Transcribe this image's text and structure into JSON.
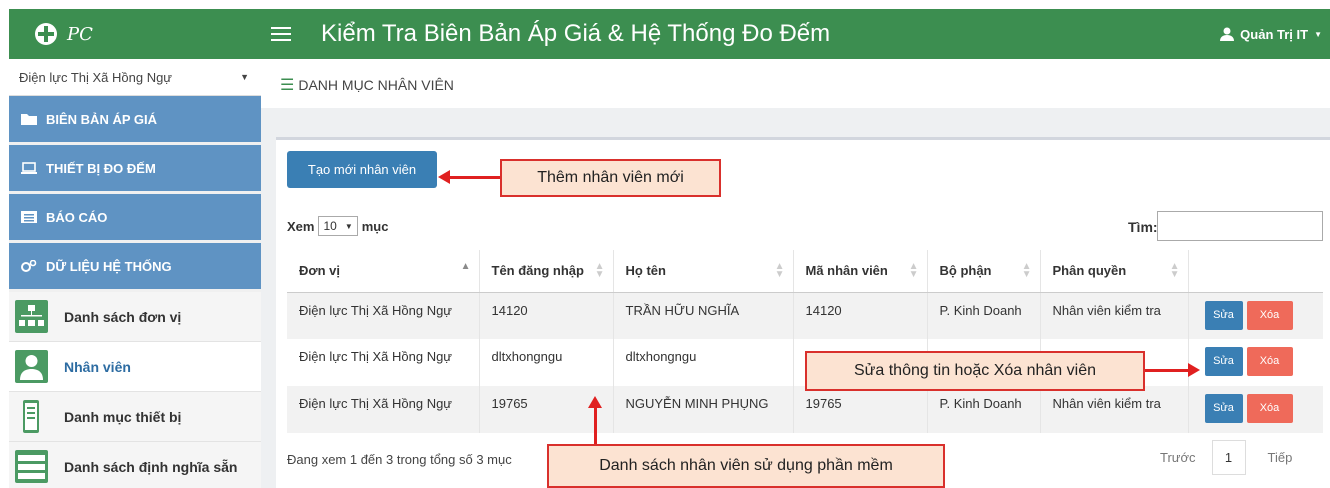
{
  "brand": {
    "text": "PC"
  },
  "sidebar": {
    "unit_select": "Điện lực Thị Xã Hồng Ngự",
    "menu": [
      {
        "label": "BIÊN BẢN ÁP GIÁ",
        "icon": "folder-icon"
      },
      {
        "label": "THIẾT BỊ ĐO ĐẾM",
        "icon": "laptop-icon"
      },
      {
        "label": "BÁO CÁO",
        "icon": "list-alt-icon"
      },
      {
        "label": "DỮ LIỆU HỆ THỐNG",
        "icon": "cogs-icon"
      }
    ],
    "sub_items": [
      {
        "label": "Danh sách đơn vị",
        "icon": "org-chart-icon"
      },
      {
        "label": "Nhân viên",
        "icon": "user-icon"
      },
      {
        "label": "Danh mục thiết bị",
        "icon": "device-icon"
      },
      {
        "label": "Danh sách định nghĩa sẵn",
        "icon": "table-icon"
      }
    ]
  },
  "topbar": {
    "title": "Kiểm Tra Biên Bản Áp Giá & Hệ Thống Đo Đếm",
    "user": "Quản Trị IT"
  },
  "page": {
    "header": "DANH MỤC NHÂN VIÊN",
    "create_button": "Tạo mới nhân viên",
    "show_label": "Xem",
    "show_value": "10",
    "show_suffix": "mục",
    "search_label": "Tìm:",
    "info": "Đang xem 1 đến 3 trong tổng số 3 mục",
    "pager": {
      "prev": "Trước",
      "page": "1",
      "next": "Tiếp"
    }
  },
  "table": {
    "headers": [
      "Đơn vị",
      "Tên đăng nhập",
      "Họ tên",
      "Mã nhân viên",
      "Bộ phận",
      "Phân quyền"
    ],
    "rows": [
      [
        "Điện lực Thị Xã Hồng Ngự",
        "14120",
        "TRẦN HỮU NGHĨA",
        "14120",
        "P. Kinh Doanh",
        "Nhân viên kiểm tra"
      ],
      [
        "Điện lực Thị Xã Hồng Ngự",
        "dltxhongngu",
        "dltxhongngu",
        "",
        "",
        ""
      ],
      [
        "Điện lực Thị Xã Hồng Ngự",
        "19765",
        "NGUYỄN MINH PHỤNG",
        "19765",
        "P. Kinh Doanh",
        "Nhân viên kiểm tra"
      ]
    ],
    "edit_label": "Sửa",
    "delete_label": "Xóa"
  },
  "annotations": {
    "add_new": "Thêm nhân viên mới",
    "edit_delete": "Sửa thông tin hoặc Xóa nhân viên",
    "list": "Danh sách nhân viên sử dụng phần mềm"
  },
  "colors": {
    "green": "#3c8e50",
    "menu_blue": "#5f93c3",
    "button_blue": "#3a7fb4",
    "delete_red": "#ef6a5a",
    "callout_bg": "#fce3d2",
    "callout_border": "#d9302c"
  }
}
